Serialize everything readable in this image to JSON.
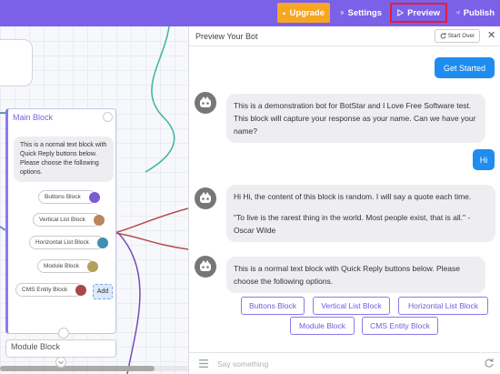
{
  "toolbar": {
    "upgrade_label": "Upgrade",
    "settings_label": "Settings",
    "preview_label": "Preview",
    "publish_label": "Publish",
    "accent_color": "#7b61e8",
    "upgrade_color": "#f5a623"
  },
  "canvas": {
    "main_block": {
      "title": "Main Block",
      "text": "This is a normal text block with Quick Reply buttons below. Please choose the following options.",
      "options": [
        "Buttons Block",
        "Vertical List Block",
        "Horizontal List Block",
        "Module Block",
        "CMS Entity Block"
      ],
      "add_label": "Add"
    },
    "module_block": {
      "title": "Module Block"
    }
  },
  "preview": {
    "title": "Preview Your Bot",
    "start_over_label": "Start Over",
    "get_started_label": "Get Started",
    "messages": {
      "bot1": "This is a demonstration bot for BotStar and I Love Free Software test. This block will capture your response as your name. Can we have your name?",
      "user1": "Hi",
      "bot2_line1": "Hi Hi, the content of this block is random. I will say a quote each time.",
      "bot2_line2": "\"To live is the rarest thing in the world. Most people exist, that is all.\" - Oscar Wilde",
      "bot3": "This is a normal text block with Quick Reply buttons below. Please choose the following options."
    },
    "quick_replies": [
      "Buttons Block",
      "Vertical List Block",
      "Horizontal List Block",
      "Module Block",
      "CMS Entity Block"
    ],
    "input_placeholder": "Say something",
    "user_bubble_color": "#1f8cf0"
  }
}
